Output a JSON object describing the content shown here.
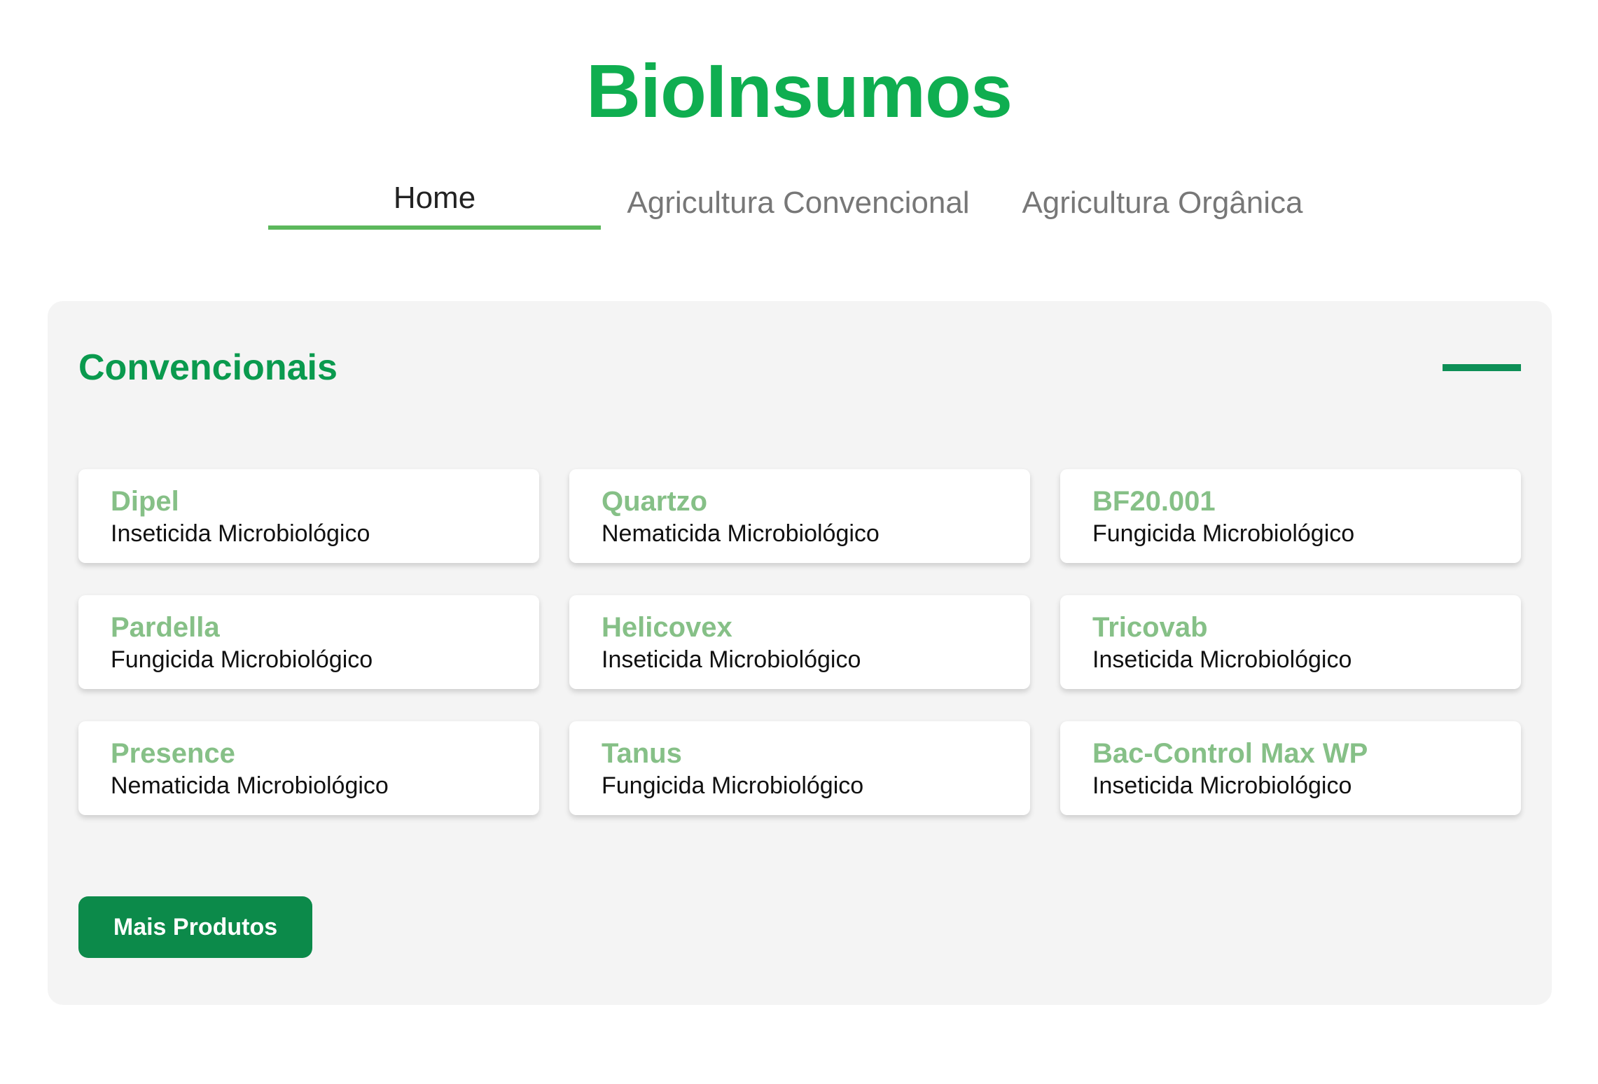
{
  "header": {
    "title": "BioInsumos"
  },
  "nav": {
    "tabs": [
      {
        "label": "Home",
        "active": true
      },
      {
        "label": "Agricultura Convencional",
        "active": false
      },
      {
        "label": "Agricultura Orgânica",
        "active": false
      }
    ]
  },
  "section": {
    "title": "Convencionais",
    "collapse_icon": "minus-icon",
    "products": [
      {
        "name": "Dipel",
        "type": "Inseticida Microbiológico"
      },
      {
        "name": "Quartzo",
        "type": "Nematicida Microbiológico"
      },
      {
        "name": "BF20.001",
        "type": "Fungicida Microbiológico"
      },
      {
        "name": "Pardella",
        "type": "Fungicida Microbiológico"
      },
      {
        "name": "Helicovex",
        "type": "Inseticida Microbiológico"
      },
      {
        "name": "Tricovab",
        "type": "Inseticida Microbiológico"
      },
      {
        "name": "Presence",
        "type": "Nematicida Microbiológico"
      },
      {
        "name": "Tanus",
        "type": "Fungicida Microbiológico"
      },
      {
        "name": "Bac-Control Max WP",
        "type": "Inseticida Microbiológico"
      }
    ],
    "more_button_label": "Mais Produtos"
  },
  "colors": {
    "brand_green": "#0fae50",
    "section_title": "#0a9a4e",
    "card_title": "#86c087",
    "button_bg": "#0c8a4a",
    "active_tab_underline": "#5cb85c",
    "panel_bg": "#f4f4f4"
  }
}
